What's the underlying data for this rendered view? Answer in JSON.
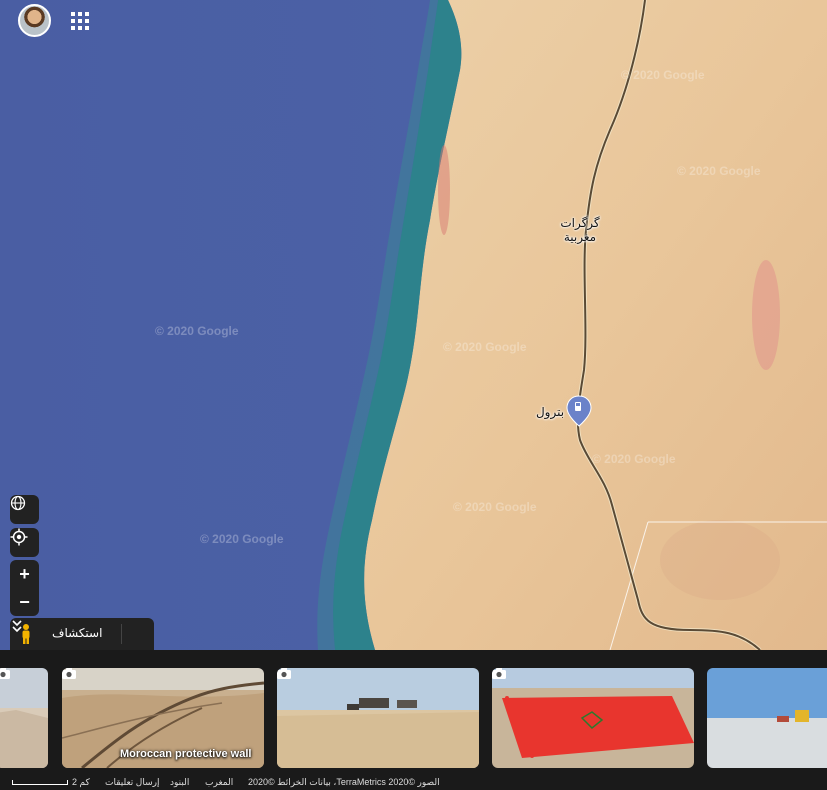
{
  "map": {
    "watermark": "© 2020 Google",
    "places": {
      "guerguerat": "گرگرات\nمغربية",
      "petrom": "بترول"
    },
    "colors": {
      "ocean": "#4a60a6",
      "desert": "#e9c79e",
      "coast": "#1e7c82",
      "road": "#5a4a35",
      "pin": "#6b82c9"
    }
  },
  "controls": {
    "explore_label": "استكشاف",
    "zoom_in": "+",
    "zoom_out": "−"
  },
  "photos": [
    {
      "caption": ""
    },
    {
      "caption": "Moroccan protective wall"
    },
    {
      "caption": ""
    },
    {
      "caption": ""
    },
    {
      "caption": ""
    }
  ],
  "footer": {
    "scale": "2 كم",
    "feedback": "إرسال تعليقات",
    "terms": "البنود",
    "country": "المغرب",
    "attribution": "الصور ©2020 TerraMetrics، بيانات الخرائط ©2020"
  }
}
